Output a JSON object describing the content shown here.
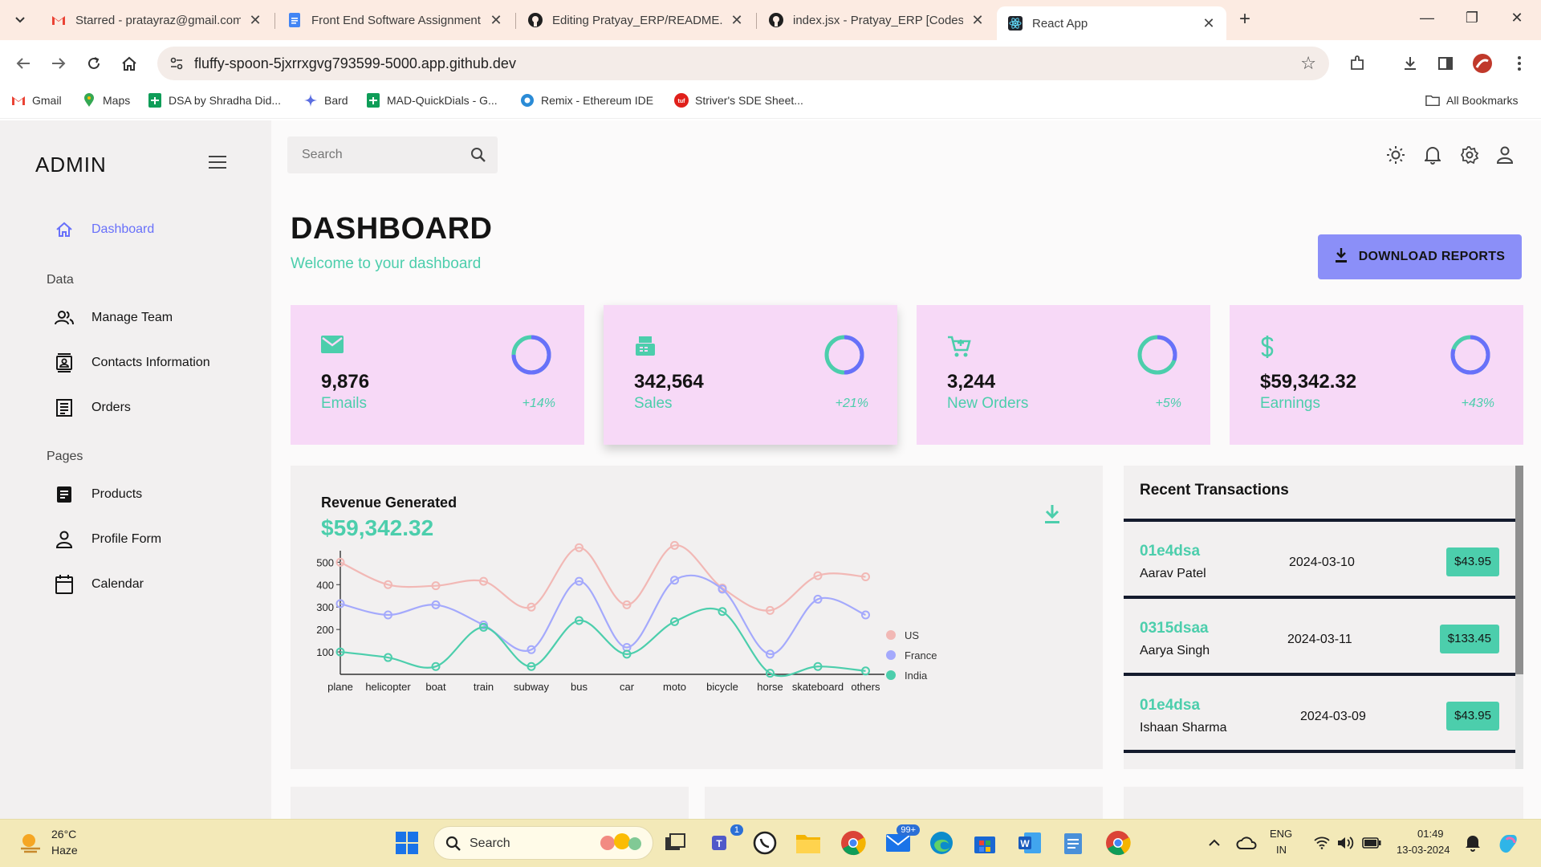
{
  "browser": {
    "tabs": [
      {
        "title": "Starred - pratayraz@gmail.com",
        "icon": "gmail-icon"
      },
      {
        "title": "Front End Software Assignment",
        "icon": "google-docs-icon"
      },
      {
        "title": "Editing Pratyay_ERP/README.m",
        "icon": "github-icon"
      },
      {
        "title": "index.jsx - Pratyay_ERP [Codesp",
        "icon": "github-icon"
      },
      {
        "title": "React App",
        "icon": "react-icon",
        "active": true
      }
    ],
    "url": "fluffy-spoon-5jxrrxgvg793599-5000.app.github.dev",
    "bookmarks": [
      {
        "label": "Gmail",
        "icon": "gmail-icon"
      },
      {
        "label": "Maps",
        "icon": "maps-icon"
      },
      {
        "label": "DSA by Shradha Did...",
        "icon": "sheets-icon"
      },
      {
        "label": "Bard",
        "icon": "bard-icon"
      },
      {
        "label": "MAD-QuickDials - G...",
        "icon": "sheets-icon"
      },
      {
        "label": "Remix - Ethereum IDE",
        "icon": "remix-icon"
      },
      {
        "label": "Striver's SDE Sheet...",
        "icon": "tuf-icon"
      }
    ],
    "all_bookmarks": "All Bookmarks"
  },
  "sidebar": {
    "brand": "ADMIN",
    "items_top": [
      {
        "label": "Dashboard",
        "icon": "home-icon",
        "active": true
      }
    ],
    "group_data": "Data",
    "items_data": [
      {
        "label": "Manage Team",
        "icon": "people-icon"
      },
      {
        "label": "Contacts Information",
        "icon": "contacts-icon"
      },
      {
        "label": "Orders",
        "icon": "receipt-icon"
      }
    ],
    "group_pages": "Pages",
    "items_pages": [
      {
        "label": "Products",
        "icon": "products-icon"
      },
      {
        "label": "Profile Form",
        "icon": "person-icon"
      },
      {
        "label": "Calendar",
        "icon": "calendar-icon"
      }
    ]
  },
  "header": {
    "search_placeholder": "Search"
  },
  "page": {
    "title": "DASHBOARD",
    "subtitle": "Welcome to your dashboard",
    "download_label": "DOWNLOAD REPORTS"
  },
  "stats": [
    {
      "value": "9,876",
      "label": "Emails",
      "pct": "+14%",
      "progress": 0.75,
      "icon": "email-icon"
    },
    {
      "value": "342,564",
      "label": "Sales",
      "pct": "+21%",
      "progress": 0.5,
      "icon": "point-of-sale-icon"
    },
    {
      "value": "3,244",
      "label": "New Orders",
      "pct": "+5%",
      "progress": 0.3,
      "icon": "cart-icon"
    },
    {
      "value": "$59,342.32",
      "label": "Earnings",
      "pct": "+43%",
      "progress": 0.8,
      "icon": "dollar-icon"
    }
  ],
  "revenue": {
    "title": "Revenue Generated",
    "value": "$59,342.32"
  },
  "chart_data": {
    "type": "line",
    "categories": [
      "plane",
      "helicopter",
      "boat",
      "train",
      "subway",
      "bus",
      "car",
      "moto",
      "bicycle",
      "horse",
      "skateboard",
      "others"
    ],
    "series": [
      {
        "name": "US",
        "color": "#f2b8b5",
        "values": [
          500,
          400,
          395,
          415,
          300,
          565,
          310,
          575,
          385,
          285,
          440,
          435
        ]
      },
      {
        "name": "France",
        "color": "#a4a9fc",
        "values": [
          315,
          265,
          310,
          220,
          110,
          415,
          120,
          420,
          380,
          90,
          335,
          265
        ]
      },
      {
        "name": "India",
        "color": "#4cceac",
        "values": [
          100,
          75,
          35,
          210,
          35,
          240,
          90,
          235,
          280,
          5,
          35,
          15
        ]
      }
    ],
    "yticks": [
      100,
      200,
      300,
      400,
      500
    ],
    "ylim": [
      0,
      580
    ],
    "legend": "right",
    "grid": false
  },
  "transactions": {
    "title": "Recent Transactions",
    "rows": [
      {
        "id": "01e4dsa",
        "user": "Aarav Patel",
        "date": "2024-03-10",
        "cost": "$43.95"
      },
      {
        "id": "0315dsaa",
        "user": "Aarya Singh",
        "date": "2024-03-11",
        "cost": "$133.45"
      },
      {
        "id": "01e4dsa",
        "user": "Ishaan Sharma",
        "date": "2024-03-09",
        "cost": "$43.95"
      }
    ]
  },
  "taskbar": {
    "temp": "26°C",
    "condition": "Haze",
    "search": "Search",
    "mail_badge": "99+",
    "teams_badge": "1",
    "lang_top": "ENG",
    "lang_bottom": "IN",
    "time": "01:49",
    "date": "13-03-2024"
  }
}
